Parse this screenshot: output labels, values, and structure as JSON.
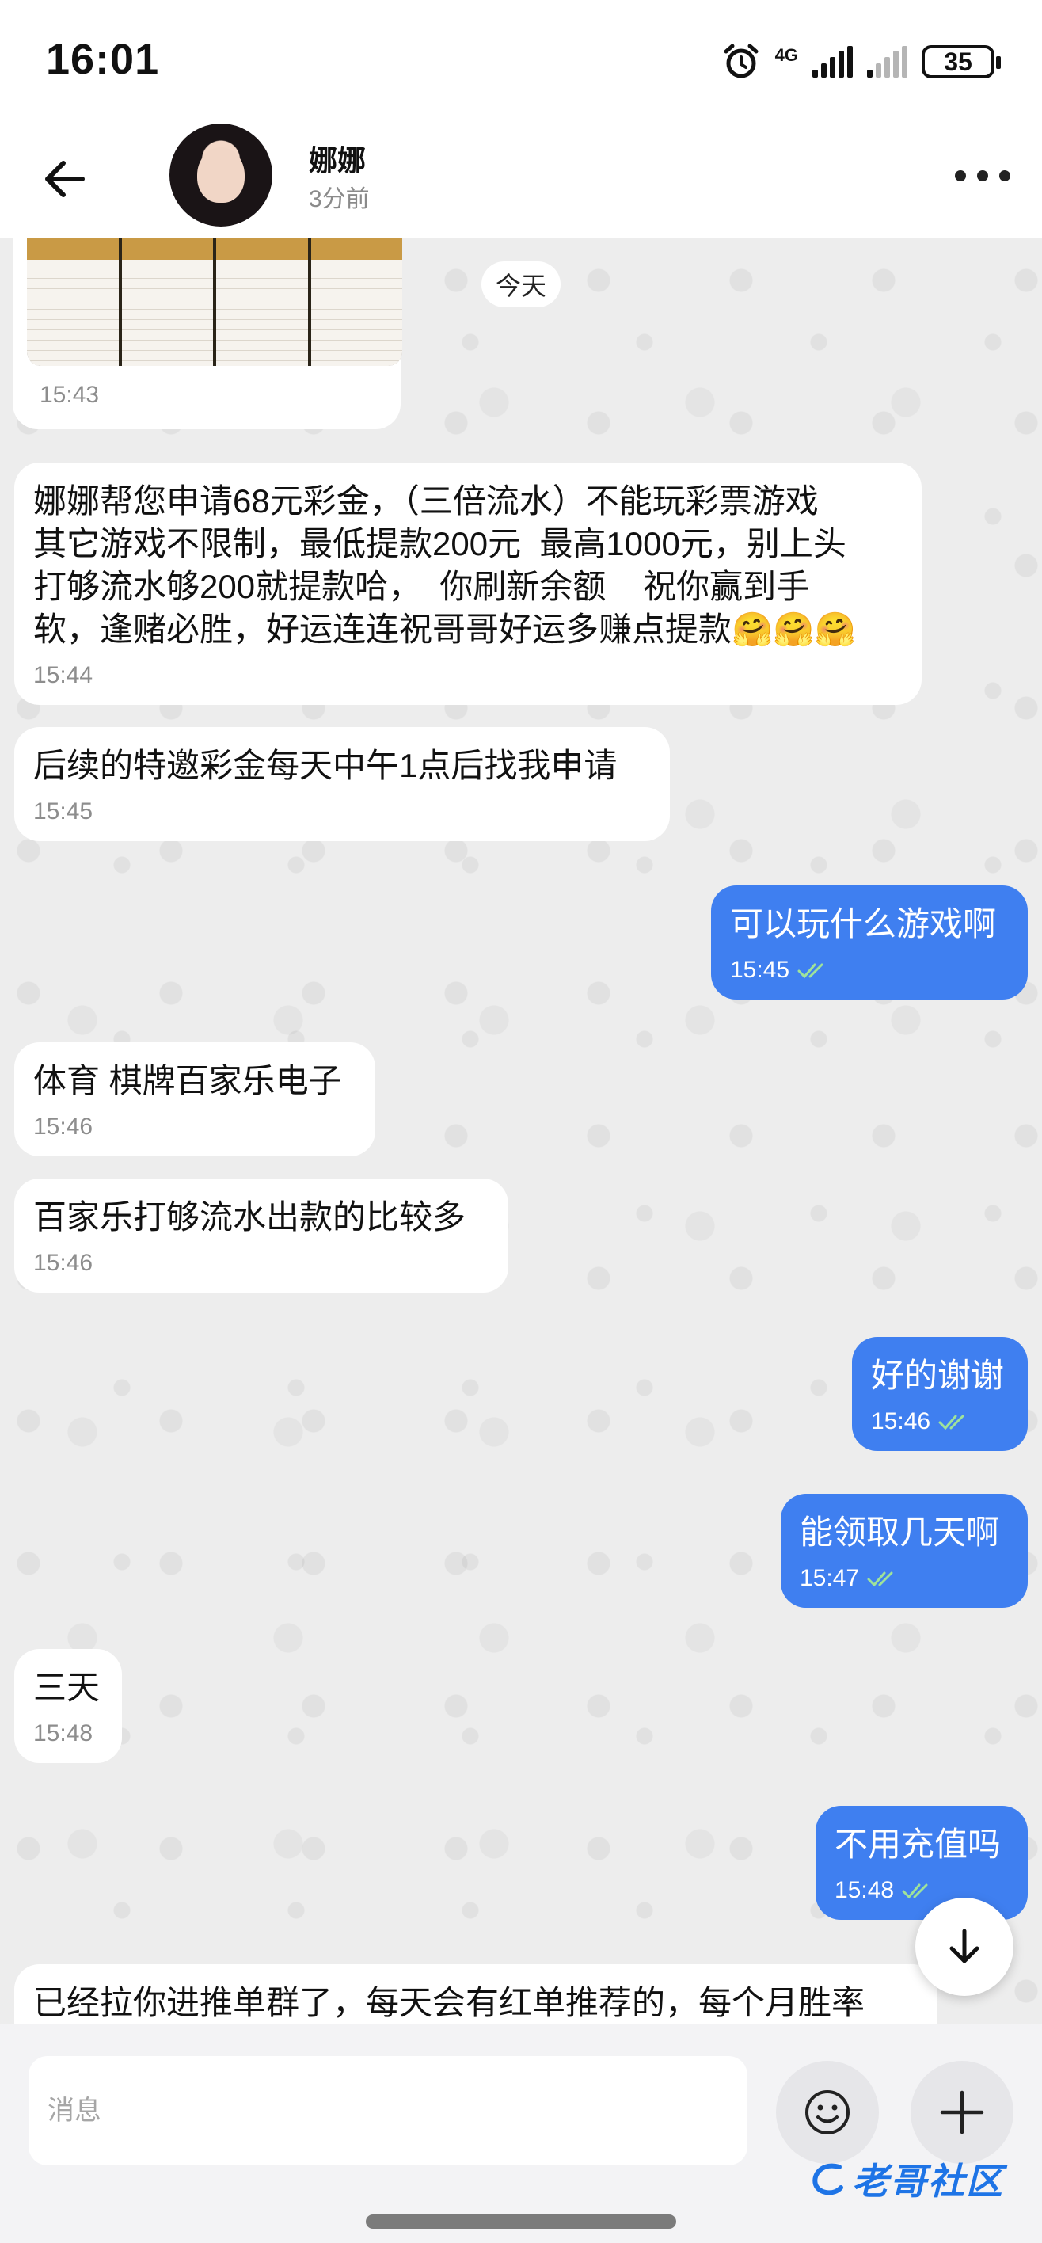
{
  "status_bar": {
    "time": "16:01",
    "network": "4G",
    "battery": "35"
  },
  "header": {
    "back_icon": "arrow-left-icon",
    "contact_name": "娜娜",
    "contact_status": "3分前",
    "more_icon": "more-dots-icon"
  },
  "chat": {
    "date_chip": "今天",
    "image_message": {
      "time": "15:43"
    },
    "messages": [
      {
        "direction": "in",
        "text": "娜娜帮您申请68元彩金，（三倍流水）不能玩彩票游戏\n其它游戏不限制，最低提款200元  最高1000元，别上头\n打够流水够200就提款哈，  你刷新余额    祝你赢到手\n软，逢赌必胜，好运连连祝哥哥好运多赚点提款🤗🤗🤗",
        "time": "15:44"
      },
      {
        "direction": "in",
        "text": "后续的特邀彩金每天中午1点后找我申请",
        "time": "15:45"
      },
      {
        "direction": "out",
        "text": "可以玩什么游戏啊",
        "time": "15:45"
      },
      {
        "direction": "in",
        "text": "体育 棋牌百家乐电子",
        "time": "15:46"
      },
      {
        "direction": "in",
        "text": "百家乐打够流水出款的比较多",
        "time": "15:46"
      },
      {
        "direction": "out",
        "text": "好的谢谢",
        "time": "15:46"
      },
      {
        "direction": "out",
        "text": "能领取几天啊",
        "time": "15:47"
      },
      {
        "direction": "in",
        "text": "三天",
        "time": "15:48"
      },
      {
        "direction": "out",
        "text": "不用充值吗",
        "time": "15:48"
      },
      {
        "direction": "in",
        "text": "已经拉你进推单群了，每天会有红单推荐的，每个月胜率",
        "time": ""
      }
    ]
  },
  "input_bar": {
    "placeholder": "消息",
    "emoji_icon": "emoji-smile-icon",
    "plus_icon": "plus-icon"
  },
  "watermark": {
    "text": "老哥社区"
  },
  "colors": {
    "outgoing_bubble": "#3f7ff0",
    "incoming_bubble": "#ffffff",
    "chat_background": "#ededed"
  }
}
